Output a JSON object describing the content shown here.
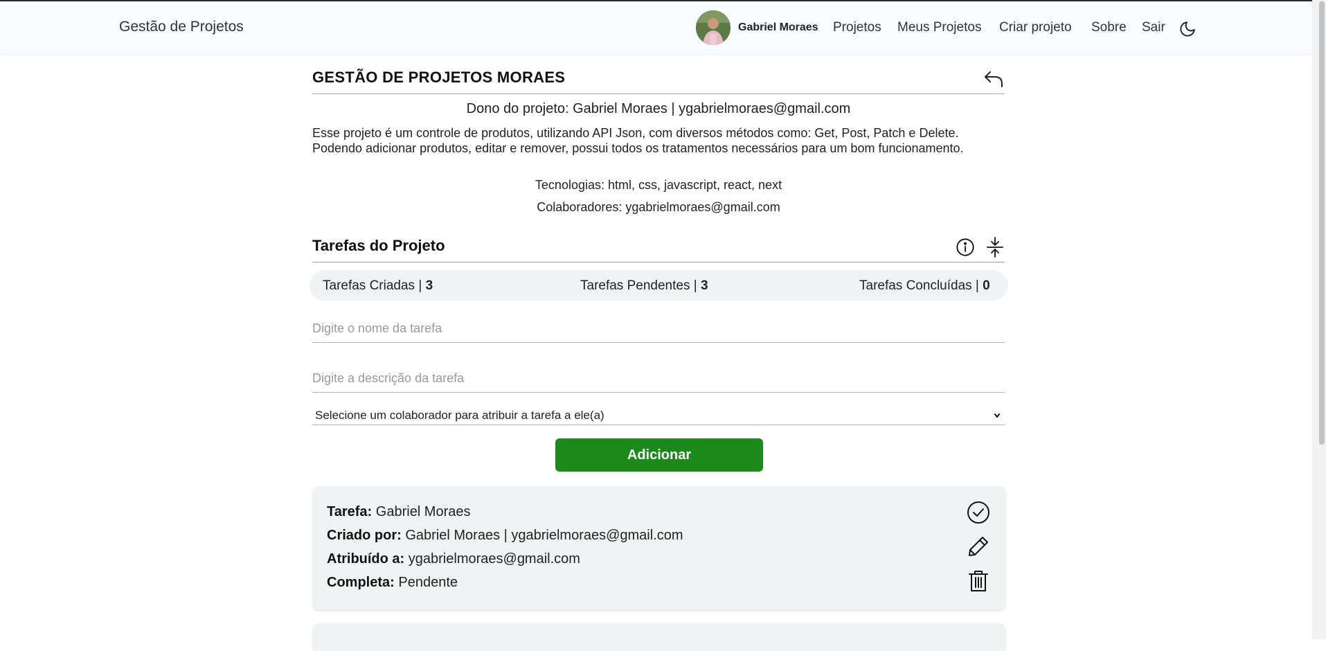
{
  "navbar": {
    "brand": "Gestão de Projetos",
    "user_name": "Gabriel Moraes",
    "links": [
      "Projetos",
      "Meus Projetos",
      "Criar projeto",
      "Sobre",
      "Sair"
    ],
    "theme_icon": "moon-icon"
  },
  "project": {
    "title": "GESTÃO DE PROJETOS MORAES",
    "back_icon": "back-arrow-icon",
    "owner": "Dono do projeto: Gabriel Moraes | ygabrielmoraes@gmail.com",
    "description": "Esse projeto é um controle de produtos, utilizando API Json, com diversos métodos como: Get, Post, Patch e Delete. Podendo adicionar produtos, editar e remover, possui todos os tratamentos necessários para um bom funcionamento.",
    "technologies": "Tecnologias: html, css, javascript, react, next",
    "collaborators": "Colaboradores: ygabrielmoraes@gmail.com"
  },
  "tasks_section": {
    "title": "Tarefas do Projeto",
    "icons": [
      "info-icon",
      "collapse-icon"
    ],
    "stats": {
      "created_label": "Tarefas Criadas | ",
      "created_value": "3",
      "pending_label": "Tarefas Pendentes | ",
      "pending_value": "3",
      "done_label": "Tarefas Concluídas | ",
      "done_value": "0"
    },
    "form": {
      "name_placeholder": "Digite o nome da tarefa",
      "description_placeholder": "Digite a descrição da tarefa",
      "collaborator_select": "Selecione um colaborador para atribuir a tarefa a ele(a)",
      "add_button": "Adicionar"
    },
    "tasks": [
      {
        "task_label": "Tarefa:",
        "task_value": "Gabriel Moraes",
        "created_label": "Criado por:",
        "created_value": "Gabriel Moraes | ygabrielmoraes@gmail.com",
        "assigned_label": "Atribuído a:",
        "assigned_value": "ygabrielmoraes@gmail.com",
        "complete_label": "Completa:",
        "complete_value": "Pendente",
        "icons": [
          "check-circle-icon",
          "pencil-icon",
          "trash-icon"
        ]
      }
    ]
  },
  "colors": {
    "accent_green": "#1b8a1b",
    "card_bg": "#f0f3f4",
    "navbar_bg": "#f9fcfe"
  }
}
